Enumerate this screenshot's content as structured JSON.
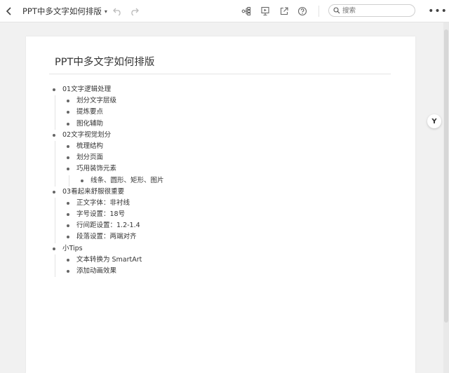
{
  "toolbar": {
    "back_icon": "chevron-left-icon",
    "doc_title": "PPT中多文字如何排版",
    "title_caret": "▾",
    "undo_icon": "undo-icon",
    "redo_icon": "redo-icon",
    "icons": [
      "structure-icon",
      "present-icon",
      "export-icon",
      "help-icon"
    ],
    "search_placeholder": "搜索",
    "more_label": "•••"
  },
  "page": {
    "title": "PPT中多文字如何排版",
    "outline": [
      {
        "text": "01文字逻辑处理",
        "children": [
          {
            "text": "划分文字层级"
          },
          {
            "text": "提炼要点"
          },
          {
            "text": "图化辅助"
          }
        ]
      },
      {
        "text": "02文字视觉划分",
        "children": [
          {
            "text": "梳理结构"
          },
          {
            "text": "划分页面"
          },
          {
            "text": "巧用装饰元素",
            "children": [
              {
                "text": "线条、圆形、矩形、图片"
              }
            ]
          }
        ]
      },
      {
        "text": "03看起来舒服很重要",
        "children": [
          {
            "text": "正文字体：非衬线"
          },
          {
            "text": "字号设置：18号"
          },
          {
            "text": "行间距设置：1.2-1.4"
          },
          {
            "text": "段落设置：两端对齐"
          }
        ]
      },
      {
        "text": "小Tips",
        "children": [
          {
            "text": "文本转换为 SmartArt"
          },
          {
            "text": "添加动画效果"
          }
        ]
      }
    ]
  },
  "side_button_label": "Y",
  "colors": {
    "text": "#333333",
    "toolbar_bg": "#ffffff",
    "canvas_bg": "#f1f1f1",
    "icon": "#666666"
  }
}
